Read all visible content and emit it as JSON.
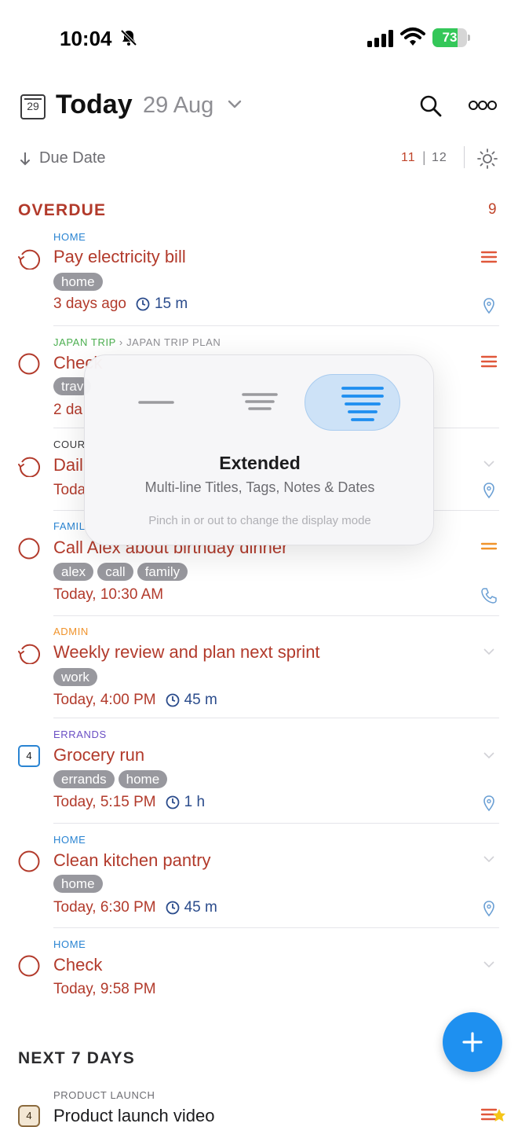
{
  "status": {
    "time": "10:04",
    "battery": "73",
    "battery_level": 0.73
  },
  "header": {
    "calendar_day": "29",
    "title": "Today",
    "date": "29 Aug"
  },
  "sort": {
    "label": "Due Date",
    "count_overdue": "11",
    "count_total": "12"
  },
  "sections": {
    "overdue": "OVERDUE",
    "overdue_count": "9",
    "next": "NEXT 7 DAYS"
  },
  "tasks": [
    {
      "project": "HOME",
      "title": "Pay electricity bill",
      "tags": [
        "home"
      ],
      "date": "3 days ago",
      "duration": "15 m"
    },
    {
      "project": "JAPAN TRIP",
      "subproject": "JAPAN TRIP PLAN",
      "title": "Check",
      "tags": [
        "trav"
      ],
      "date": "2 da"
    },
    {
      "project": "COUR",
      "title": "Dail",
      "date": "Toda"
    },
    {
      "project": "FAMIL",
      "title": "Call Alex about birthday dinner",
      "tags": [
        "alex",
        "call",
        "family"
      ],
      "date": "Today, 10:30 AM"
    },
    {
      "project": "ADMIN",
      "title": "Weekly review and plan next sprint",
      "tags": [
        "work"
      ],
      "date": "Today, 4:00 PM",
      "duration": "45 m"
    },
    {
      "project": "ERRANDS",
      "title": "Grocery run",
      "tags": [
        "errands",
        "home"
      ],
      "date": "Today, 5:15 PM",
      "duration": "1 h",
      "cal_day": "4"
    },
    {
      "project": "HOME",
      "title": "Clean kitchen pantry",
      "tags": [
        "home"
      ],
      "date": "Today, 6:30 PM",
      "duration": "45 m"
    },
    {
      "project": "HOME",
      "title": "Check",
      "date": "Today, 9:58 PM"
    }
  ],
  "next_tasks": [
    {
      "project": "PRODUCT LAUNCH",
      "title": "Product launch video",
      "cal_day": "4"
    }
  ],
  "popup": {
    "title": "Extended",
    "subtitle": "Multi-line Titles, Tags, Notes & Dates",
    "hint": "Pinch in or out to change the display mode"
  },
  "colors": {
    "overdue": "#b23a2b",
    "accent": "#1e90f0",
    "duration": "#2b4c8c",
    "project_home": "#2a84d2",
    "project_japan": "#4caf50",
    "project_admin": "#f0932b",
    "project_errands": "#6a4fc4"
  }
}
